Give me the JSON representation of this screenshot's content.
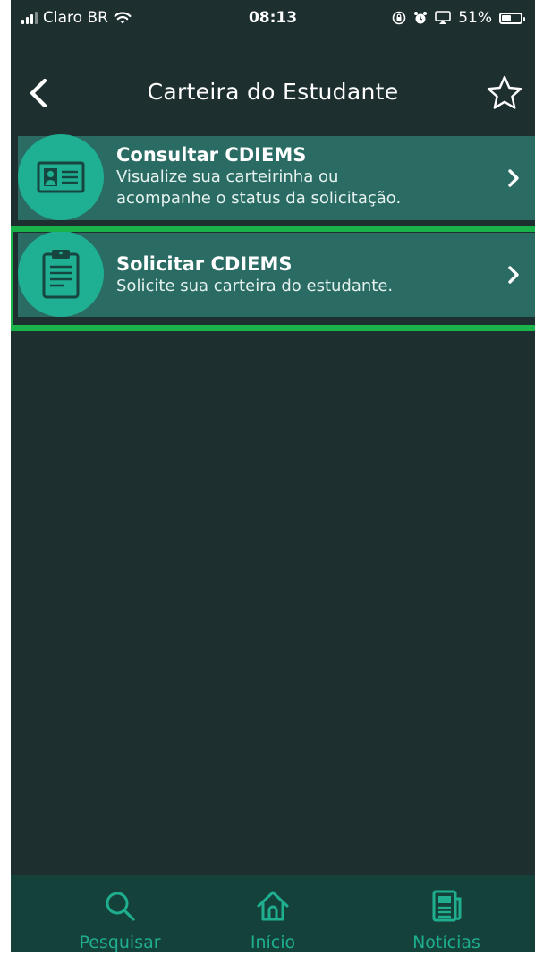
{
  "status_bar": {
    "carrier": "Claro BR",
    "time": "08:13",
    "battery_percent": "51%",
    "battery_level": 0.51
  },
  "nav": {
    "title": "Carteira do Estudante"
  },
  "items": [
    {
      "title": "Consultar CDIEMS",
      "description_line1": "Visualize sua carteirinha ou",
      "description_line2": "acompanhe o status da solicitação."
    },
    {
      "title": "Solicitar CDIEMS",
      "description_line1": "Solicite sua carteira do estudante."
    }
  ],
  "tabbar": {
    "search_label": "Pesquisar",
    "home_label": "Início",
    "news_label": "Notícias"
  },
  "colors": {
    "background": "#1e2f2f",
    "item_background": "#2a6b63",
    "accent": "#1faf93",
    "tabbar": "#15413b",
    "highlight": "#19b34a"
  },
  "icons": [
    "signal-icon",
    "wifi-icon",
    "lock-rotation-icon",
    "alarm-icon",
    "airplay-icon",
    "battery-icon",
    "back-arrow-icon",
    "star-icon",
    "id-card-icon",
    "clipboard-icon",
    "chevron-right-icon",
    "search-icon",
    "home-icon",
    "newspaper-icon"
  ]
}
